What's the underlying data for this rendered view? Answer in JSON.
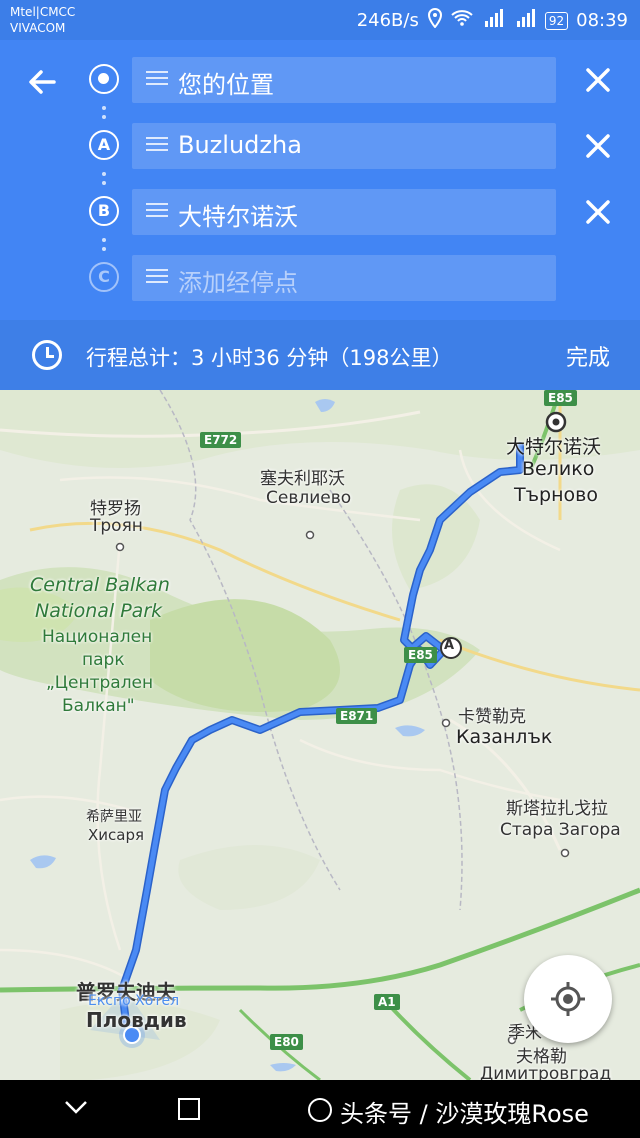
{
  "status_bar": {
    "carrier_line1": "Mtel|CMCC",
    "carrier_line2": "VIVACOM",
    "speed": "246B/s",
    "battery": "92",
    "time": "08:39"
  },
  "directions": {
    "back_icon": "arrow-left-icon",
    "stops": [
      {
        "marker": "",
        "label": "您的位置"
      },
      {
        "marker": "A",
        "label": "Buzludzha"
      },
      {
        "marker": "B",
        "label": "大特尔诺沃"
      },
      {
        "marker": "C",
        "label": "添加经停点"
      }
    ]
  },
  "summary": {
    "text": "行程总计：3 小时36 分钟（198公里）",
    "done_label": "完成"
  },
  "map": {
    "labels": {
      "veliko_cn": "大特尔诺沃",
      "veliko_bg1": "Велико",
      "veliko_bg2": "Търново",
      "sevlievo_cn": "塞夫利耶沃",
      "sevlievo_bg": "Севлиево",
      "troyan_cn": "特罗扬",
      "troyan_bg": "Троян",
      "park_en1": "Central Balkan",
      "park_en2": "National Park",
      "park_bg1": "Национален",
      "park_bg2": "парк",
      "park_bg3": "„Централен",
      "park_bg4": "Балкан\"",
      "kazanlak_cn": "卡赞勒克",
      "kazanlak_bg": "Казанлък",
      "stara_cn": "斯塔拉扎戈拉",
      "stara_bg": "Стара Загора",
      "hisarya_cn": "希萨里亚",
      "hisarya_bg": "Хисаря",
      "plovdiv_cn": "普罗夫迪夫",
      "expo": "Експо Хотел",
      "plovdiv_bg": "Пловдив",
      "dimitrovgrad_cn1": "季米",
      "dimitrovgrad_cn2": "夫格勒",
      "dimitrovgrad_bg": "Димитровград"
    },
    "shields": {
      "e85_top": "E85",
      "e772": "E772",
      "e85_mid": "E85",
      "e871": "E871",
      "a1": "A1",
      "e80": "E80"
    },
    "marker_a": "A",
    "colors": {
      "route": "#4a8af4",
      "park": "#cfe3b0",
      "water": "#a9c8f0"
    }
  },
  "nav_bar": {
    "watermark": "头条号 / 沙漠玫瑰Rose"
  }
}
